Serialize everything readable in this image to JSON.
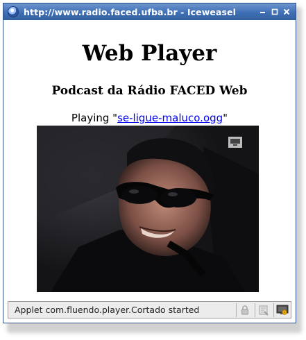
{
  "window": {
    "title": "http://www.radio.faced.ufba.br - Iceweasel"
  },
  "page": {
    "heading": "Web Player",
    "subheading": "Podcast da Rádio FACED Web",
    "playing_prefix": "Playing \"",
    "file_link": "se-ligue-maluco.ogg",
    "playing_suffix": "\""
  },
  "status_bar": {
    "text": "Applet com.fluendo.player.Cortado started"
  },
  "icons": [
    "browser-logo-icon",
    "minimize-icon",
    "maximize-icon",
    "close-icon",
    "lock-icon",
    "popup-blocker-icon",
    "java-console-icon"
  ],
  "colors": {
    "titlebar": "#3f6fb4",
    "link": "#0000ee"
  }
}
